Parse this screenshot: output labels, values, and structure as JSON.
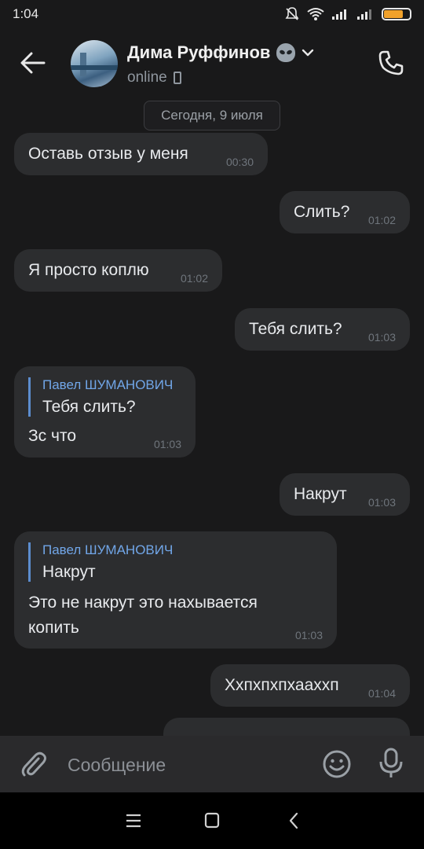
{
  "status_bar": {
    "time": "1:04",
    "icons": [
      "mute-icon",
      "wifi-icon",
      "signal-icon",
      "signal-icon",
      "battery-icon"
    ],
    "battery_level": 0.75,
    "battery_color": "#f0a12b"
  },
  "header": {
    "contact_name": "Дима Руффинов",
    "status": "online",
    "name_emoji": "alien-icon"
  },
  "chat": {
    "date": "Сегодня, 9 июля",
    "messages": [
      {
        "text": "Оставь отзыв у меня",
        "time": "00:30"
      },
      {
        "text": "Слить?",
        "time": "01:02"
      },
      {
        "text": "Я просто коплю",
        "time": "01:02"
      },
      {
        "text": "Тебя слить?",
        "time": "01:03"
      },
      {
        "reply_author": "Павел ШУМАНОВИЧ",
        "reply_text": "Тебя слить?",
        "text": "Зс что",
        "time": "01:03"
      },
      {
        "text": "Накрут",
        "time": "01:03"
      },
      {
        "reply_author": "Павел ШУМАНОВИЧ",
        "reply_text": "Накрут",
        "text_line1": "Это не накрут это нахывается",
        "text_line2": "копить",
        "time": "01:03"
      },
      {
        "text": "Ххпхпхпхааххп",
        "time": "01:04"
      }
    ]
  },
  "input": {
    "placeholder": "Сообщение"
  },
  "colors": {
    "background": "#19191a",
    "bubble": "#2c2d2f",
    "reply_accent": "#71a6e8"
  }
}
